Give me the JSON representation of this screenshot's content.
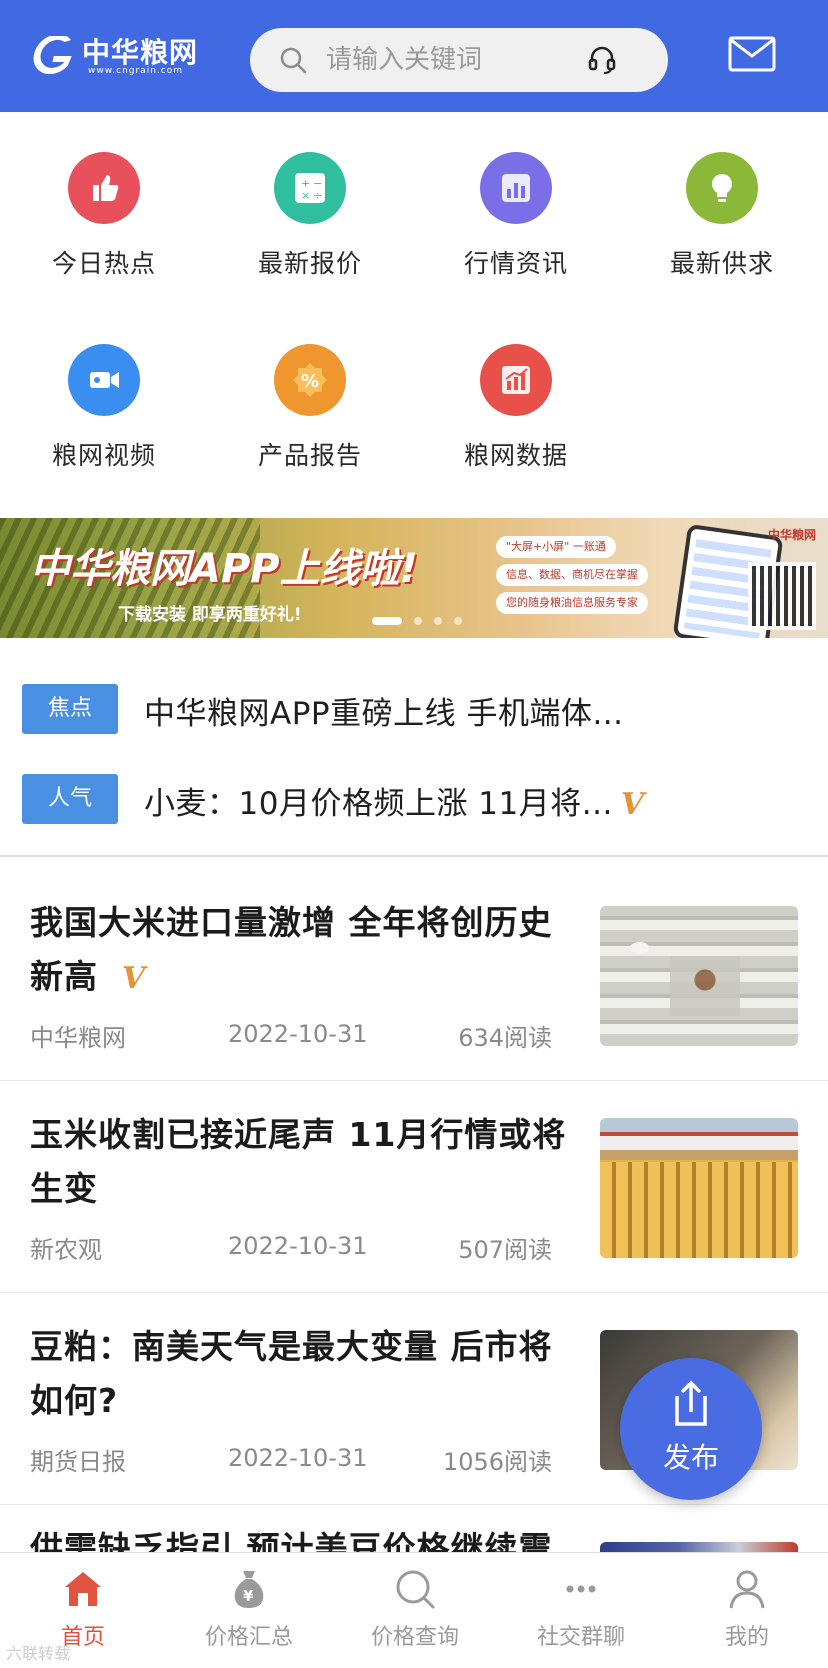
{
  "header": {
    "logo_text": "中华粮网",
    "logo_url_text": "www.cngrain.com",
    "search_placeholder": "请输入关键词"
  },
  "categories": [
    {
      "label": "今日热点",
      "icon": "thumbs-up-icon",
      "color": "#e8505b"
    },
    {
      "label": "最新报价",
      "icon": "calculator-icon",
      "color": "#2fbf9f"
    },
    {
      "label": "行情资讯",
      "icon": "bar-chart-icon",
      "color": "#7b6fe8"
    },
    {
      "label": "最新供求",
      "icon": "light-bulb-icon",
      "color": "#8cb83a"
    },
    {
      "label": "粮网视频",
      "icon": "video-camera-icon",
      "color": "#3a8ef0"
    },
    {
      "label": "产品报告",
      "icon": "percent-badge-icon",
      "color": "#f0962e"
    },
    {
      "label": "粮网数据",
      "icon": "growth-chart-icon",
      "color": "#e8504a"
    }
  ],
  "banner": {
    "title": "中华粮网APP上线啦!",
    "subtitle": "下载安装  即享两重好礼!",
    "tags": [
      "\"大屏+小屏\" 一账通",
      "信息、数据、商机尽在掌握",
      "您的随身粮油信息服务专家"
    ],
    "brand": "中华粮网"
  },
  "tickers": [
    {
      "badge": "焦点",
      "text": "中华粮网APP重磅上线 手机端体..."
    },
    {
      "badge": "人气",
      "text": "小麦：10月价格频上涨 11月将..."
    }
  ],
  "news": [
    {
      "title_line1": "我国大米进口量激增 全年将创历史",
      "title_line2": "新高",
      "source": "中华粮网",
      "date": "2022-10-31",
      "reads": "634阅读"
    },
    {
      "title_line1": "玉米收割已接近尾声 11月行情或将",
      "title_line2": "生变",
      "source": "新农观",
      "date": "2022-10-31",
      "reads": "507阅读"
    },
    {
      "title_line1": "豆粕：南美天气是最大变量 后市将",
      "title_line2": "如何?",
      "source": "期货日报",
      "date": "2022-10-31",
      "reads": "1056阅读"
    },
    {
      "title_line1": "供需缺乏指引 预计美豆价格继续震",
      "title_line2": ""
    }
  ],
  "publish": {
    "label": "发布"
  },
  "tabbar": [
    {
      "label": "首页",
      "active": true
    },
    {
      "label": "价格汇总",
      "active": false
    },
    {
      "label": "价格查询",
      "active": false
    },
    {
      "label": "社交群聊",
      "active": false
    },
    {
      "label": "我的",
      "active": false
    }
  ],
  "watermark": "六联转载",
  "colors": {
    "brand_blue": "#4169e1",
    "tag_blue": "#4a90e2",
    "active_red": "#e0533f",
    "v_orange": "#e0953a"
  }
}
